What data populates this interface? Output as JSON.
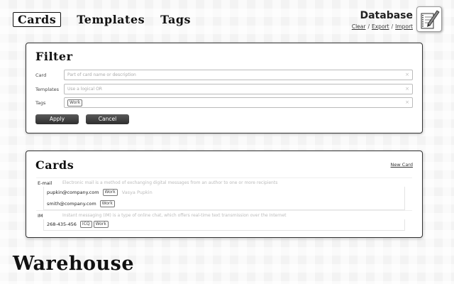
{
  "nav": {
    "tabs": [
      {
        "label": "Cards",
        "active": true
      },
      {
        "label": "Templates",
        "active": false
      },
      {
        "label": "Tags",
        "active": false
      }
    ]
  },
  "database": {
    "title": "Database",
    "actions": [
      "Clear",
      "Export",
      "Import"
    ],
    "separator": "/",
    "icon": "notebook-pen-icon"
  },
  "filter": {
    "title": "Filter",
    "card_label": "Card",
    "card_placeholder": "Part of card name or description",
    "templates_label": "Templates",
    "templates_placeholder": "Use a logical OR",
    "tags_label": "Tags",
    "tags_value": "Work",
    "apply_label": "Apply",
    "cancel_label": "Cancel"
  },
  "cards": {
    "title": "Cards",
    "new_card_label": "New Card",
    "categories": [
      {
        "label": "E-mail",
        "description": "Electronic mail is a method of exchanging digital messages from an author to one or more recipients",
        "items": [
          {
            "value": "pupkin@company.com",
            "tags": [
              "Work"
            ],
            "note": "Vasya Pupkin"
          },
          {
            "value": "smith@company.com",
            "tags": [
              "Work"
            ],
            "note": ""
          }
        ]
      },
      {
        "label": "IM",
        "description": "Instant messaging (IM) is a type of online chat, which offers real-time text transmission over the Internet",
        "items": [
          {
            "value": "268-435-456",
            "tags": [
              "ICQ",
              "Work"
            ],
            "note": ""
          }
        ]
      }
    ]
  },
  "footer": {
    "title": "Warehouse"
  },
  "colors": {
    "panel_border": "#333333",
    "button": "#3a3a3a",
    "background": "#f3f3f3"
  }
}
